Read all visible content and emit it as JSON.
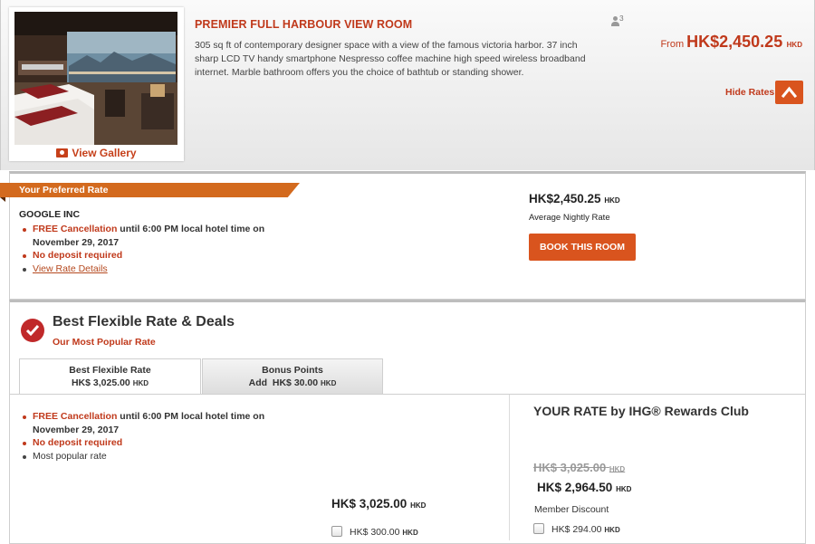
{
  "room": {
    "title": "PREMIER FULL HARBOUR VIEW ROOM",
    "description": "305 sq ft of contemporary designer space with a view of the famous victoria harbor. 37 inch sharp LCD TV handy smartphone Nespresso coffee machine high speed wireless broadband internet. Marble bathroom offers you the choice of bathtub or standing shower.",
    "gallery_label": "View Gallery",
    "max_guests": "3",
    "from_label": "From",
    "from_price": "HK$2,450.25",
    "currency": "HKD",
    "hide_rates_label": "Hide Rates",
    "image_alt": "Hotel room with two beds and harbour view window"
  },
  "preferred_rate": {
    "ribbon": "Your Preferred Rate",
    "company": "GOOGLE INC",
    "benefits": [
      {
        "highlight": "FREE Cancellation",
        "rest": " until 6:00 PM local hotel time on November 29, 2017"
      },
      {
        "highlight": "No deposit required"
      }
    ],
    "details_link": "View Rate Details",
    "price": "HK$2,450.25",
    "currency": "HKD",
    "price_caption": "Average Nightly Rate",
    "book_button": "BOOK THIS ROOM"
  },
  "flexible": {
    "title": "Best Flexible Rate & Deals",
    "subtitle": "Our Most Popular Rate",
    "tabs": [
      {
        "label": "Best Flexible Rate",
        "prefix": "",
        "price": "HK$ 3,025.00",
        "currency": "HKD"
      },
      {
        "label": "Bonus Points",
        "prefix": "Add",
        "price": "HK$ 30.00",
        "currency": "HKD"
      }
    ],
    "benefits": [
      {
        "highlight": "FREE Cancellation",
        "rest": " until 6:00 PM local hotel time on November 29, 2017"
      },
      {
        "highlight": "No deposit required"
      },
      {
        "plain": "Most popular rate"
      }
    ],
    "price": "HK$ 3,025.00",
    "currency": "HKD",
    "addon_price": "HK$ 300.00",
    "ihg": {
      "title": "YOUR RATE by IHG® Rewards Club",
      "original_price": "HK$ 3,025.00",
      "member_price": "HK$ 2,964.50",
      "member_discount_label": "Member Discount",
      "addon_price": "HK$ 294.00",
      "currency": "HKD"
    }
  },
  "colors": {
    "accent": "#c0391b",
    "button": "#d9541e",
    "ribbon": "#d36a1e",
    "check": "#c0292a"
  }
}
